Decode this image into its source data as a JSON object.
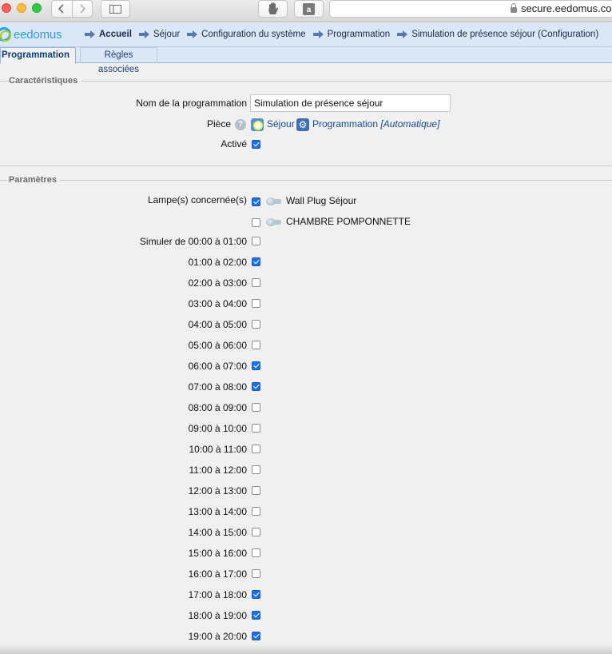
{
  "browser": {
    "url": "secure.eedomus.com"
  },
  "app": {
    "logo_text": "eedomus"
  },
  "breadcrumb": [
    {
      "label": "Accueil",
      "bold": true
    },
    {
      "label": "Séjour",
      "bold": false
    },
    {
      "label": "Configuration du système",
      "bold": false
    },
    {
      "label": "Programmation",
      "bold": false
    },
    {
      "label": "Simulation de présence séjour (Configuration)",
      "bold": false
    }
  ],
  "tabs": [
    {
      "label": "Programmation",
      "active": true
    },
    {
      "label": "Règles associées",
      "active": false
    }
  ],
  "caracteristiques": {
    "title": "Caractéristiques",
    "name_label": "Nom de la programmation",
    "name_value": "Simulation de présence séjour",
    "piece_label": "Pièce",
    "help_glyph": "?",
    "room_name": "Séjour",
    "prog_link": "Programmation",
    "prog_mode": "[Automatique]",
    "active_label": "Activé",
    "active_checked": true
  },
  "parametres": {
    "title": "Paramètres",
    "lamps_label": "Lampe(s) concernée(s)",
    "lamps": [
      {
        "name": "Wall Plug Séjour",
        "checked": true
      },
      {
        "name": "CHAMBRE POMPONNETTE",
        "checked": false
      }
    ],
    "slots": [
      {
        "label": "Simuler de 00:00 à 01:00",
        "checked": false
      },
      {
        "label": "01:00 à 02:00",
        "checked": true
      },
      {
        "label": "02:00 à 03:00",
        "checked": false
      },
      {
        "label": "03:00 à 04:00",
        "checked": false
      },
      {
        "label": "04:00 à 05:00",
        "checked": false
      },
      {
        "label": "05:00 à 06:00",
        "checked": false
      },
      {
        "label": "06:00 à 07:00",
        "checked": true
      },
      {
        "label": "07:00 à 08:00",
        "checked": true
      },
      {
        "label": "08:00 à 09:00",
        "checked": false
      },
      {
        "label": "09:00 à 10:00",
        "checked": false
      },
      {
        "label": "10:00 à 11:00",
        "checked": false
      },
      {
        "label": "11:00 à 12:00",
        "checked": false
      },
      {
        "label": "12:00 à 13:00",
        "checked": false
      },
      {
        "label": "13:00 à 14:00",
        "checked": false
      },
      {
        "label": "14:00 à 15:00",
        "checked": false
      },
      {
        "label": "15:00 à 16:00",
        "checked": false
      },
      {
        "label": "16:00 à 17:00",
        "checked": false
      },
      {
        "label": "17:00 à 18:00",
        "checked": true
      },
      {
        "label": "18:00 à 19:00",
        "checked": true
      },
      {
        "label": "19:00 à 20:00",
        "checked": true
      }
    ]
  },
  "icons": {
    "back": "chevron-left-icon",
    "forward": "chevron-right-icon",
    "sidebar": "sidebar-icon",
    "hand": "hand-icon",
    "amazon": "amazon-icon",
    "lock": "lock-icon"
  }
}
